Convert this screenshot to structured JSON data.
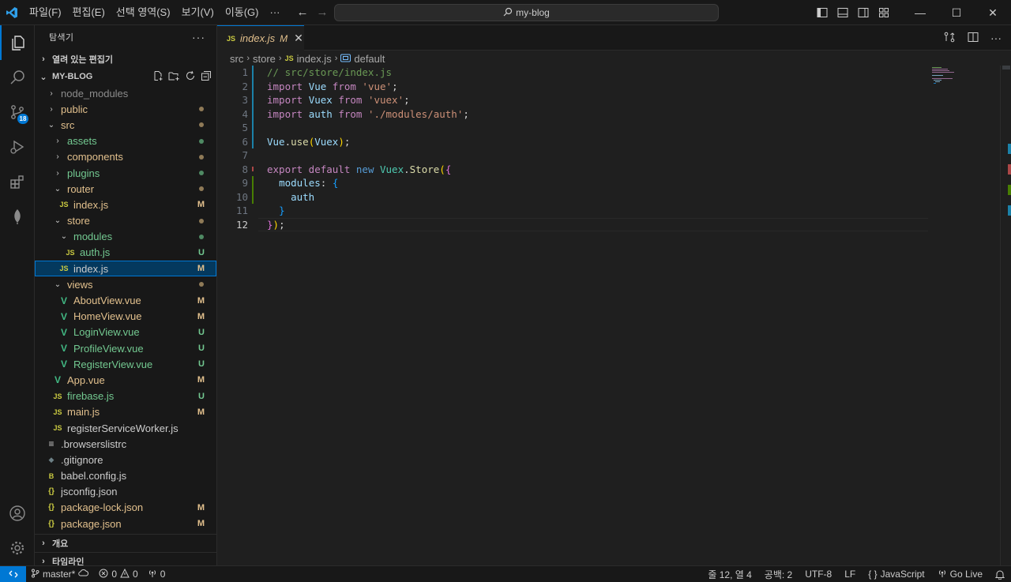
{
  "titlebar": {
    "menus": [
      "파일(F)",
      "편집(E)",
      "선택 영역(S)",
      "보기(V)",
      "이동(G)",
      "···"
    ],
    "search_text": "my-blog"
  },
  "activity": {
    "scm_badge": "18"
  },
  "sidebar": {
    "title": "탐색기",
    "more": "···",
    "open_editors": "열려 있는 편집기",
    "project": "MY-BLOG",
    "outline": "개요",
    "timeline": "타임라인",
    "items": [
      {
        "label": "node_modules",
        "chev": "›",
        "indent": 0,
        "icon": "",
        "status": "",
        "color": "c-dim"
      },
      {
        "label": "public",
        "chev": "›",
        "indent": 0,
        "icon": "",
        "status": "dot",
        "color": "c-mod"
      },
      {
        "label": "src",
        "chev": "⌄",
        "indent": 0,
        "icon": "",
        "status": "dot",
        "color": "c-mod"
      },
      {
        "label": "assets",
        "chev": "›",
        "indent": 1,
        "icon": "",
        "status": "dotg",
        "color": "c-new"
      },
      {
        "label": "components",
        "chev": "›",
        "indent": 1,
        "icon": "",
        "status": "dot",
        "color": "c-mod"
      },
      {
        "label": "plugins",
        "chev": "›",
        "indent": 1,
        "icon": "",
        "status": "dotg",
        "color": "c-new"
      },
      {
        "label": "router",
        "chev": "⌄",
        "indent": 1,
        "icon": "",
        "status": "dot",
        "color": "c-mod"
      },
      {
        "label": "index.js",
        "chev": "",
        "indent": 2,
        "icon": "JS",
        "status": "M",
        "color": "c-mod"
      },
      {
        "label": "store",
        "chev": "⌄",
        "indent": 1,
        "icon": "",
        "status": "dot",
        "color": "c-mod"
      },
      {
        "label": "modules",
        "chev": "⌄",
        "indent": 2,
        "icon": "",
        "status": "dotg",
        "color": "c-new"
      },
      {
        "label": "auth.js",
        "chev": "",
        "indent": 3,
        "icon": "JS",
        "status": "U",
        "color": "c-new"
      },
      {
        "label": "index.js",
        "chev": "",
        "indent": 2,
        "icon": "JS",
        "status": "M",
        "color": "c-norm",
        "selected": true
      },
      {
        "label": "views",
        "chev": "⌄",
        "indent": 1,
        "icon": "",
        "status": "dot",
        "color": "c-mod"
      },
      {
        "label": "AboutView.vue",
        "chev": "",
        "indent": 2,
        "icon": "V",
        "status": "M",
        "color": "c-mod"
      },
      {
        "label": "HomeView.vue",
        "chev": "",
        "indent": 2,
        "icon": "V",
        "status": "M",
        "color": "c-mod"
      },
      {
        "label": "LoginView.vue",
        "chev": "",
        "indent": 2,
        "icon": "V",
        "status": "U",
        "color": "c-new"
      },
      {
        "label": "ProfileView.vue",
        "chev": "",
        "indent": 2,
        "icon": "V",
        "status": "U",
        "color": "c-new"
      },
      {
        "label": "RegisterView.vue",
        "chev": "",
        "indent": 2,
        "icon": "V",
        "status": "U",
        "color": "c-new"
      },
      {
        "label": "App.vue",
        "chev": "",
        "indent": 1,
        "icon": "V",
        "status": "M",
        "color": "c-mod"
      },
      {
        "label": "firebase.js",
        "chev": "",
        "indent": 1,
        "icon": "JS",
        "status": "U",
        "color": "c-new"
      },
      {
        "label": "main.js",
        "chev": "",
        "indent": 1,
        "icon": "JS",
        "status": "M",
        "color": "c-mod"
      },
      {
        "label": "registerServiceWorker.js",
        "chev": "",
        "indent": 1,
        "icon": "JS",
        "status": "",
        "color": "c-norm"
      },
      {
        "label": ".browserslistrc",
        "chev": "",
        "indent": 0,
        "icon": "≡",
        "status": "",
        "color": "c-norm"
      },
      {
        "label": ".gitignore",
        "chev": "",
        "indent": 0,
        "icon": "◆",
        "status": "",
        "color": "c-norm"
      },
      {
        "label": "babel.config.js",
        "chev": "",
        "indent": 0,
        "icon": "B",
        "status": "",
        "color": "c-norm"
      },
      {
        "label": "jsconfig.json",
        "chev": "",
        "indent": 0,
        "icon": "{}",
        "status": "",
        "color": "c-norm"
      },
      {
        "label": "package-lock.json",
        "chev": "",
        "indent": 0,
        "icon": "{}",
        "status": "M",
        "color": "c-mod"
      },
      {
        "label": "package.json",
        "chev": "",
        "indent": 0,
        "icon": "{}",
        "status": "M",
        "color": "c-mod"
      }
    ]
  },
  "editor": {
    "tab": {
      "icon": "JS",
      "name": "index.js",
      "status": "M",
      "close": "✕"
    },
    "breadcrumb": [
      "src",
      "store",
      "index.js",
      "default"
    ],
    "current_line": 12,
    "lines": [
      [
        [
          "cm",
          "// src/store/index.js"
        ]
      ],
      [
        [
          "k",
          "import "
        ],
        [
          "v",
          "Vue"
        ],
        [
          "k",
          " from "
        ],
        [
          "s",
          "'vue'"
        ],
        [
          "p",
          ";"
        ]
      ],
      [
        [
          "k",
          "import "
        ],
        [
          "v",
          "Vuex"
        ],
        [
          "k",
          " from "
        ],
        [
          "s",
          "'vuex'"
        ],
        [
          "p",
          ";"
        ]
      ],
      [
        [
          "k",
          "import "
        ],
        [
          "v",
          "auth"
        ],
        [
          "k",
          " from "
        ],
        [
          "s",
          "'./modules/auth'"
        ],
        [
          "p",
          ";"
        ]
      ],
      [],
      [
        [
          "v",
          "Vue"
        ],
        [
          "p",
          "."
        ],
        [
          "fn",
          "use"
        ],
        [
          "b1",
          "("
        ],
        [
          "v",
          "Vuex"
        ],
        [
          "b1",
          ")"
        ],
        [
          "p",
          ";"
        ]
      ],
      [],
      [
        [
          "k",
          "export default "
        ],
        [
          "kb",
          "new "
        ],
        [
          "cl",
          "Vuex"
        ],
        [
          "p",
          "."
        ],
        [
          "fn",
          "Store"
        ],
        [
          "b1",
          "("
        ],
        [
          "b2",
          "{"
        ]
      ],
      [
        [
          "p",
          "  "
        ],
        [
          "v",
          "modules"
        ],
        [
          "p",
          ": "
        ],
        [
          "b3",
          "{"
        ]
      ],
      [
        [
          "p",
          "    "
        ],
        [
          "v",
          "auth"
        ]
      ],
      [
        [
          "p",
          "  "
        ],
        [
          "b3",
          "}"
        ]
      ],
      [
        [
          "b2",
          "}"
        ],
        [
          "b1",
          ")"
        ],
        [
          "p",
          ";"
        ]
      ]
    ]
  },
  "statusbar": {
    "branch": "master*",
    "errors": "0",
    "warnings": "0",
    "ports": "0",
    "position": "줄 12, 열 4",
    "spaces": "공백: 2",
    "encoding": "UTF-8",
    "eol": "LF",
    "language": "JavaScript",
    "golive": "Go Live"
  }
}
